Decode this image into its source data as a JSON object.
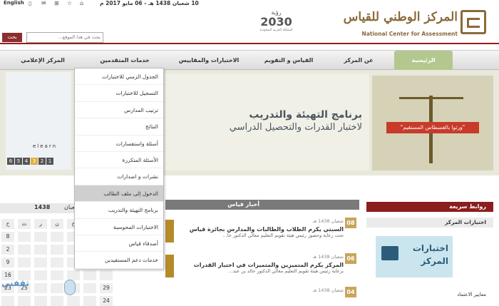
{
  "topbar": {
    "lang": "English",
    "date": "10 شعبان 1438 هـ - 06 مايو 2017 م"
  },
  "header": {
    "search_button": "بحث",
    "search_placeholder": "بحث في هذا الموقع...",
    "vision_title": "رؤية",
    "vision_year": "2030",
    "vision_sub": "المملكة العربية السعودية",
    "logo_ar": "المركز الوطني للقياس",
    "logo_en": "National Center for Assessment"
  },
  "nav": {
    "items": [
      "الرئيسية",
      "عن المركز",
      "القياس و التقويم",
      "الاختبارات والمقاييس",
      "خدمات المتقدمين",
      "المركز الإعلامي"
    ]
  },
  "banner": {
    "title": "برنامج التهيئة والتدريب",
    "line2": "لاختبار القدرات والتحصيل الدراسي",
    "quote": "\"ورثوا بالقسطاس المستقيم\"",
    "elearn": "elearn",
    "digits": [
      "6",
      "5",
      "4",
      "3",
      "2",
      "1"
    ]
  },
  "dropdown": {
    "items": [
      "الجدول الزمني للاختبارات",
      "التسجيل للاختبارات",
      "ترتيب المدارس",
      "النتائج",
      "أسئلة واستفسارات",
      "الأسئلة المتكررة",
      "نشرات و اصدارات",
      "الدخول إلى ملف الطالب",
      "برنامج التهيئة والتدريب",
      "الاختبارات المحوسبة",
      "أصدقاء قياس",
      "خدمات دعم المستفيدين"
    ],
    "hover_index": 7
  },
  "calendar": {
    "month": "شعبان",
    "year": "1438",
    "arrow": "›",
    "rows": [
      [
        "ح",
        "ث",
        "ر",
        "ن",
        "ح",
        "ج",
        "س"
      ],
      [
        "8",
        "",
        "",
        "",
        "",
        "",
        ""
      ],
      [
        "2",
        "",
        "",
        "",
        "",
        "",
        ""
      ],
      [
        "9",
        "",
        "",
        "",
        "",
        "",
        ""
      ],
      [
        "16",
        "",
        "",
        "",
        "",
        "",
        ""
      ],
      [
        "23",
        "25",
        "",
        "",
        "",
        "",
        "29"
      ],
      [
        "",
        "",
        "",
        "",
        "",
        "",
        "24"
      ]
    ]
  },
  "news": {
    "heading": "أخبار قياس",
    "items": [
      {
        "day": "08",
        "date": "شعبان 1438 هـ",
        "title": "السبتي يكرم الطلاب والطالبات والمدارس بجائزة قياس",
        "desc": "تحت رعاية وحضور رئيس هيئة تقويم التعليم معالي الدكتور خا..."
      },
      {
        "day": "06",
        "date": "شعبان 1438 هـ",
        "title": "المركز يكرم المتميزين والمتميزات في اختبار القدرات",
        "desc": "برعاية رئيس هيئة تقويم التعليم معالي الدكتور خالد بن عبد..."
      },
      {
        "day": "04",
        "date": "شعبان 1438 هـ",
        "title": "",
        "desc": ""
      }
    ]
  },
  "quick": {
    "heading": "روابط سريعة",
    "sub": "اختبارات المركز",
    "panel_l1": "اختبارات",
    "panel_l2": "المركز",
    "foot": "معايير الاعتماد"
  },
  "watermark": "ثقفني"
}
